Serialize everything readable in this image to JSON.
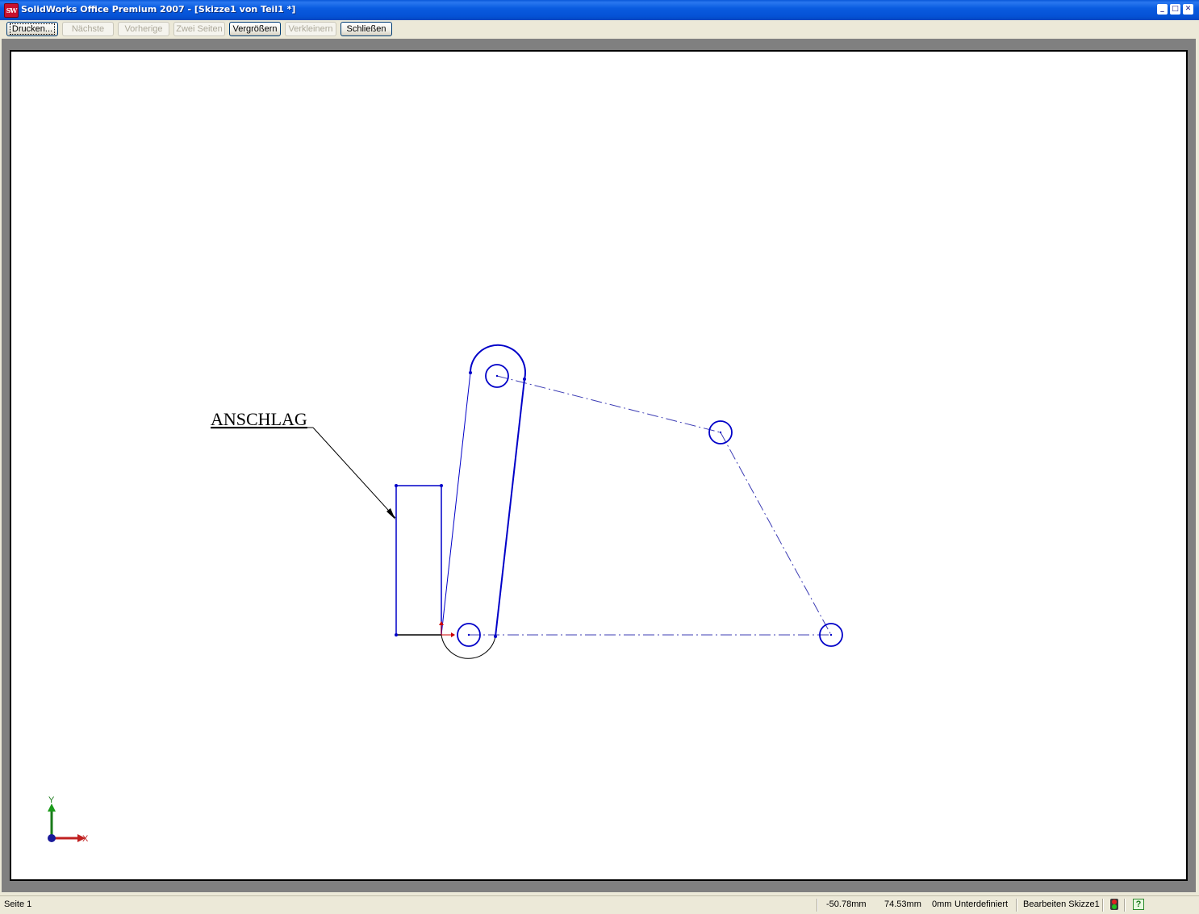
{
  "window": {
    "app_icon_label": "SW",
    "title": "SolidWorks Office Premium 2007 - [Skizze1 von Teil1 *]",
    "controls": {
      "minimize": "_",
      "maximize": "□",
      "close": "✕"
    }
  },
  "toolbar": {
    "print": "Drucken...",
    "next": "Nächste",
    "previous": "Vorherige",
    "two_pages": "Zwei Seiten",
    "zoom_in": "Vergrößern",
    "zoom_out": "Verkleinern",
    "close": "Schließen"
  },
  "sketch": {
    "note_text": "ANSCHLAG",
    "triad": {
      "y_label": "Y",
      "x_label": "X"
    },
    "colors": {
      "sketch_blue": "#0000c8",
      "construction_blue": "#3c3cb4",
      "black": "#000000",
      "origin_red": "#cc0000",
      "triad_green": "#1a7a1a",
      "triad_red": "#c02020",
      "triad_blue": "#1a1a9a"
    }
  },
  "status": {
    "page": "Seite 1",
    "x_coord": "-50.78mm",
    "y_coord": "74.53mm",
    "z_coord": "0mm",
    "definition": "Unterdefiniert",
    "mode": "Bearbeiten Skizze1",
    "icons": [
      "rebuild-traffic-light-icon",
      "help-icon"
    ]
  }
}
